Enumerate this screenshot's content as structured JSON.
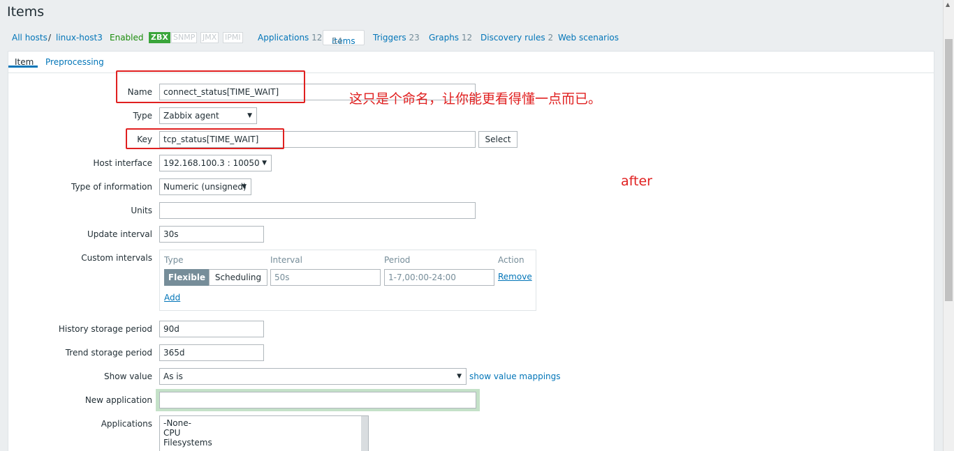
{
  "page_title": "Items",
  "breadcrumb": {
    "all_hosts": "All hosts",
    "separator": "/",
    "host": "linux-host3",
    "status": "Enabled",
    "badges": [
      "ZBX",
      "SNMP",
      "JMX",
      "IPMI"
    ],
    "applications": {
      "label": "Applications",
      "count": "12"
    },
    "items": {
      "label": "Items",
      "count": "54"
    },
    "triggers": {
      "label": "Triggers",
      "count": "23"
    },
    "graphs": {
      "label": "Graphs",
      "count": "12"
    },
    "discovery": {
      "label": "Discovery rules",
      "count": "2"
    },
    "web": "Web scenarios"
  },
  "tabs": {
    "item": "Item",
    "preprocessing": "Preprocessing"
  },
  "form": {
    "name": {
      "label": "Name",
      "value": "connect_status[TIME_WAIT]"
    },
    "type": {
      "label": "Type",
      "value": "Zabbix agent"
    },
    "key": {
      "label": "Key",
      "value": "tcp_status[TIME_WAIT]",
      "button": "Select"
    },
    "host_interface": {
      "label": "Host interface",
      "value": "192.168.100.3 : 10050"
    },
    "type_of_information": {
      "label": "Type of information",
      "value": "Numeric (unsigned)"
    },
    "units": {
      "label": "Units",
      "value": ""
    },
    "update_interval": {
      "label": "Update interval",
      "value": "30s"
    },
    "custom_intervals": {
      "label": "Custom intervals",
      "headers": {
        "type": "Type",
        "interval": "Interval",
        "period": "Period",
        "action": "Action"
      },
      "mode_flexible": "Flexible",
      "mode_scheduling": "Scheduling",
      "interval_placeholder": "50s",
      "period_placeholder": "1-7,00:00-24:00",
      "remove": "Remove",
      "add": "Add"
    },
    "history": {
      "label": "History storage period",
      "value": "90d"
    },
    "trend": {
      "label": "Trend storage period",
      "value": "365d"
    },
    "show_value": {
      "label": "Show value",
      "value": "As is",
      "link": "show value mappings"
    },
    "new_application": {
      "label": "New application",
      "value": ""
    },
    "applications": {
      "label": "Applications",
      "options": [
        "-None-",
        "CPU",
        "Filesystems"
      ]
    }
  },
  "annotations": {
    "note_cn": "这只是个命名，让你能更看得懂一点而已。",
    "after": "after",
    "color": "#e02020"
  }
}
